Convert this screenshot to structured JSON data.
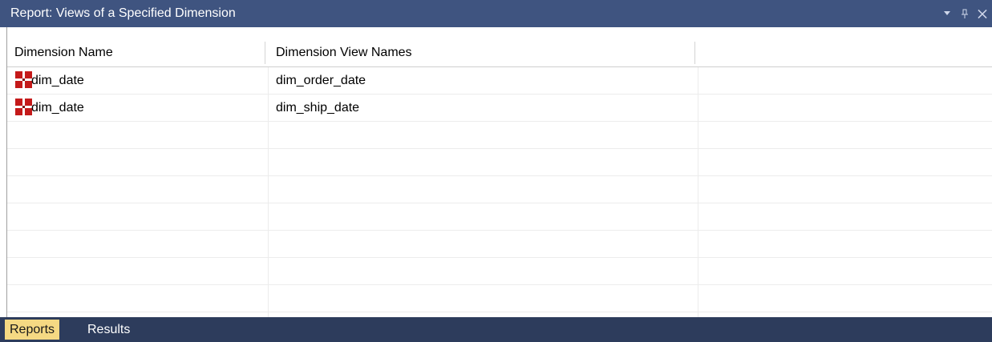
{
  "window": {
    "title": "Report: Views of a Specified Dimension"
  },
  "table": {
    "columns": [
      "Dimension Name",
      "Dimension View Names",
      ""
    ],
    "rows": [
      {
        "dimension_name": "dim_date",
        "dimension_view_name": "dim_order_date",
        "icon": "dimension-table-icon"
      },
      {
        "dimension_name": "dim_date",
        "dimension_view_name": "dim_ship_date",
        "icon": "dimension-table-icon"
      }
    ]
  },
  "bottom_tabs": [
    "Reports",
    "Results"
  ],
  "colors": {
    "titlebar": "#3f5480",
    "bottombar": "#2d3c5c",
    "active_tab": "#f5d983",
    "dimension_icon": "#c41a1a"
  }
}
